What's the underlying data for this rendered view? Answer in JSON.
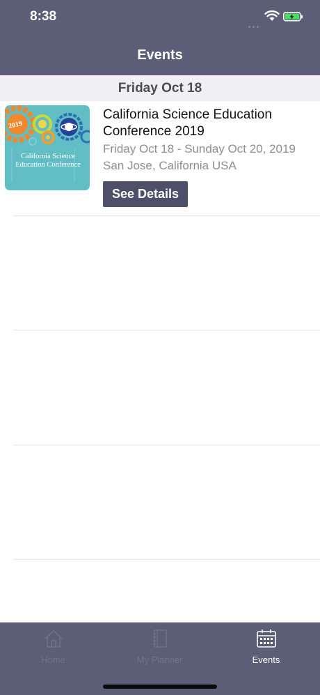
{
  "status_bar": {
    "time": "8:38"
  },
  "nav": {
    "title": "Events"
  },
  "section": {
    "date": "Friday Oct 18"
  },
  "event": {
    "title": "California Science Education Conference 2019",
    "dates": "Friday Oct 18 - Sunday Oct 20, 2019",
    "location": "San Jose, California USA",
    "button_label": "See Details",
    "thumbnail": {
      "badge_text": "2019",
      "caption_line1": "California Science",
      "caption_line2": "Education Conference",
      "bg_color": "#54b7bf"
    }
  },
  "tabs": [
    {
      "label": "Home",
      "icon": "house-icon",
      "active": false
    },
    {
      "label": "My Planner",
      "icon": "notebook-icon",
      "active": false
    },
    {
      "label": "Events",
      "icon": "calendar-icon",
      "active": true
    }
  ],
  "colors": {
    "header_bg": "#5b5e76",
    "button_bg": "#4d5068",
    "section_bg": "#efeff4"
  }
}
